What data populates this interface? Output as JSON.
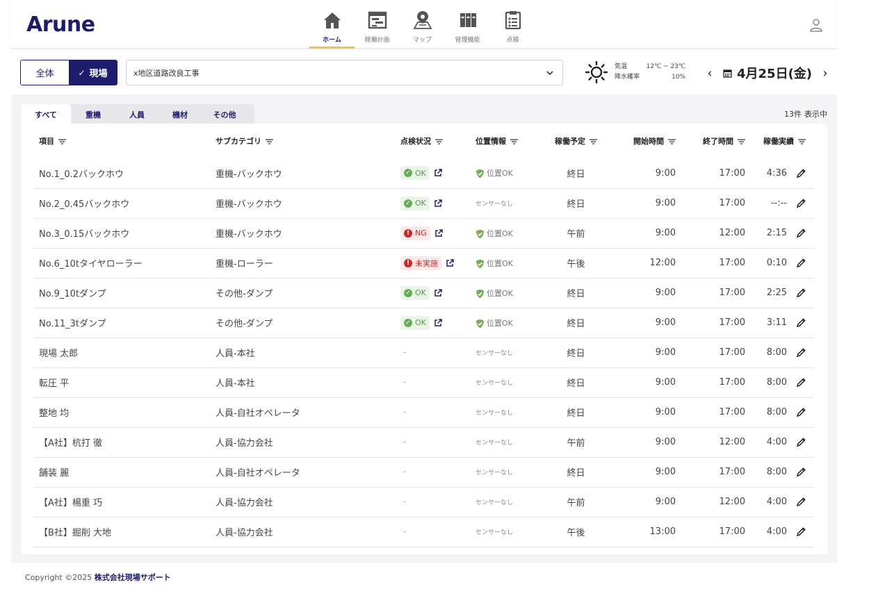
{
  "app": {
    "logo": "Arune"
  },
  "nav": [
    {
      "label": "ホーム",
      "icon": "home-icon",
      "active": true
    },
    {
      "label": "稼働計画",
      "icon": "gantt-icon",
      "active": false
    },
    {
      "label": "マップ",
      "icon": "map-pin-icon",
      "active": false
    },
    {
      "label": "管理機能",
      "icon": "binders-icon",
      "active": false
    },
    {
      "label": "点検",
      "icon": "clipboard-icon",
      "active": false
    }
  ],
  "filter": {
    "all_label": "全体",
    "site_label": "現場",
    "site_value": "x地区道路改良工事"
  },
  "weather": {
    "icon": "sun-icon",
    "temp_label": "気温",
    "temp_value": "12℃ ~ 23℃",
    "rain_label": "降水確率",
    "rain_value": "10%"
  },
  "date": {
    "text": "4月25日(金)"
  },
  "tabs": [
    "すべて",
    "重機",
    "人員",
    "機材",
    "その他"
  ],
  "count": {
    "value": "13件",
    "label": "表示中"
  },
  "columns": [
    "項目",
    "サブカテゴリ",
    "点検状況",
    "位置情報",
    "稼働予定",
    "開始時間",
    "終了時間",
    "稼働実績"
  ],
  "rows": [
    {
      "item": "No.1_0.2バックホウ",
      "sub": "重機-バックホウ",
      "inspection": "OK",
      "location": "位置OK",
      "plan": "終日",
      "start": "9:00",
      "end": "17:00",
      "actual": "4:36"
    },
    {
      "item": "No.2_0.45バックホウ",
      "sub": "重機-バックホウ",
      "inspection": "OK",
      "location": "センサーなし",
      "plan": "終日",
      "start": "9:00",
      "end": "17:00",
      "actual": "--:--"
    },
    {
      "item": "No.3_0.15バックホウ",
      "sub": "重機-バックホウ",
      "inspection": "NG",
      "location": "位置OK",
      "plan": "午前",
      "start": "9:00",
      "end": "12:00",
      "actual": "2:15"
    },
    {
      "item": "No.6_10tタイヤローラー",
      "sub": "重機-ローラー",
      "inspection": "未実施",
      "location": "位置OK",
      "plan": "午後",
      "start": "12:00",
      "end": "17:00",
      "actual": "0:10"
    },
    {
      "item": "No.9_10tダンプ",
      "sub": "その他-ダンプ",
      "inspection": "OK",
      "location": "位置OK",
      "plan": "終日",
      "start": "9:00",
      "end": "17:00",
      "actual": "2:25"
    },
    {
      "item": "No.11_3tダンプ",
      "sub": "その他-ダンプ",
      "inspection": "OK",
      "location": "位置OK",
      "plan": "終日",
      "start": "9:00",
      "end": "17:00",
      "actual": "3:11"
    },
    {
      "item": "現場 太郎",
      "sub": "人員-本社",
      "inspection": "-",
      "location": "センサーなし",
      "plan": "終日",
      "start": "9:00",
      "end": "17:00",
      "actual": "8:00"
    },
    {
      "item": "転圧 平",
      "sub": "人員-本社",
      "inspection": "-",
      "location": "センサーなし",
      "plan": "終日",
      "start": "9:00",
      "end": "17:00",
      "actual": "8:00"
    },
    {
      "item": "整地 均",
      "sub": "人員-自社オペレータ",
      "inspection": "-",
      "location": "センサーなし",
      "plan": "終日",
      "start": "9:00",
      "end": "17:00",
      "actual": "8:00"
    },
    {
      "item": "【A社】杭打 徹",
      "sub": "人員-協力会社",
      "inspection": "-",
      "location": "センサーなし",
      "plan": "午前",
      "start": "9:00",
      "end": "12:00",
      "actual": "4:00"
    },
    {
      "item": "舗装 麗",
      "sub": "人員-自社オペレータ",
      "inspection": "-",
      "location": "センサーなし",
      "plan": "終日",
      "start": "9:00",
      "end": "17:00",
      "actual": "8:00"
    },
    {
      "item": "【A社】楊重 巧",
      "sub": "人員-協力会社",
      "inspection": "-",
      "location": "センサーなし",
      "plan": "午前",
      "start": "9:00",
      "end": "12:00",
      "actual": "4:00"
    },
    {
      "item": "【B社】掘削 大地",
      "sub": "人員-協力会社",
      "inspection": "-",
      "location": "センサーなし",
      "plan": "午後",
      "start": "13:00",
      "end": "17:00",
      "actual": "4:00"
    }
  ],
  "footer": {
    "copyright": "Copyright ©2025",
    "company": "株式会社現場サポート"
  },
  "colors": {
    "brand": "#1e1d6b",
    "accent": "#f0c23d",
    "ok": "#6aab57",
    "ng": "#c62828"
  }
}
